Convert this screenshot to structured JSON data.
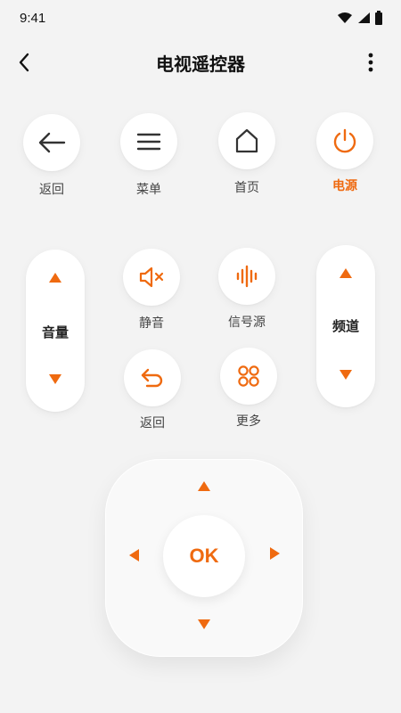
{
  "status": {
    "time": "9:41",
    "icons": [
      "wifi-icon",
      "signal-icon",
      "battery-icon"
    ]
  },
  "header": {
    "title": "电视遥控器",
    "back_icon": "chevron-left-icon",
    "more_icon": "more-vertical-icon"
  },
  "top_buttons": [
    {
      "label": "返回",
      "icon": "arrow-left-icon"
    },
    {
      "label": "菜单",
      "icon": "menu-icon"
    },
    {
      "label": "首页",
      "icon": "home-icon"
    },
    {
      "label": "电源",
      "icon": "power-icon",
      "accent": true
    }
  ],
  "volume": {
    "label": "音量",
    "up_icon": "triangle-up-icon",
    "down_icon": "triangle-down-icon"
  },
  "channel": {
    "label": "频道",
    "up_icon": "triangle-up-icon",
    "down_icon": "triangle-down-icon"
  },
  "middle_buttons": [
    {
      "label": "静音",
      "icon": "mute-icon"
    },
    {
      "label": "信号源",
      "icon": "signal-source-icon"
    },
    {
      "label": "返回",
      "icon": "return-icon"
    },
    {
      "label": "更多",
      "icon": "grid-icon"
    }
  ],
  "dpad": {
    "ok_label": "OK"
  },
  "colors": {
    "accent": "#ef6a10",
    "background": "#f3f3f3",
    "button": "#ffffff"
  }
}
